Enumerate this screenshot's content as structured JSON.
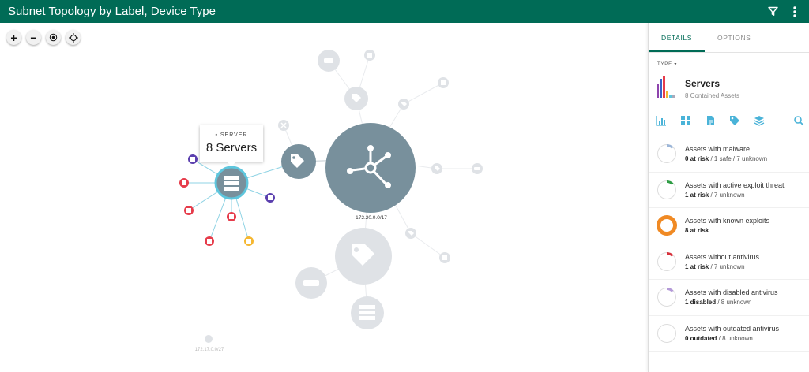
{
  "header": {
    "title": "Subnet Topology by Label, Device Type"
  },
  "zoom": {
    "zoom_in": "+",
    "zoom_out": "−"
  },
  "graph": {
    "main_node_label": "172.20.0.0/17",
    "small_node_label": "172.17.0.0/27",
    "tooltip": {
      "kicker": "SERVER",
      "value": "8 Servers"
    },
    "colors": {
      "hub": "#78909c",
      "faded": "#dfe2e6",
      "edge": "#cfe8f0",
      "highlight": "#5ec6dd",
      "red": "#e63c4b",
      "purple": "#5b3fae",
      "yellow": "#f5b731"
    }
  },
  "panel": {
    "tabs": [
      "DETAILS",
      "OPTIONS"
    ],
    "type_label": "TYPE",
    "name": "Servers",
    "subtitle": "8 Contained Assets",
    "risks": [
      {
        "title": "Assets with malware",
        "count": "0 at risk",
        "rest": " / 1 safe / 7 unknown",
        "color": "#9cb6d8",
        "fraction": 0.125
      },
      {
        "title": "Assets with active exploit threat",
        "count": "1 at risk",
        "rest": " / 7 unknown",
        "color": "#2e9d44",
        "fraction": 0.125
      },
      {
        "title": "Assets with known exploits",
        "count": "8 at risk",
        "rest": "",
        "color": "#f08a24",
        "fraction": 1.0
      },
      {
        "title": "Assets without antivirus",
        "count": "1 at risk",
        "rest": " / 7 unknown",
        "color": "#d8313c",
        "fraction": 0.125
      },
      {
        "title": "Assets with disabled antivirus",
        "count": "1 disabled",
        "rest": " / 8 unknown",
        "color": "#b49ad8",
        "fraction": 0.125
      },
      {
        "title": "Assets with outdated antivirus",
        "count": "0 outdated",
        "rest": " / 8 unknown",
        "color": "#cccccc",
        "fraction": 0
      }
    ]
  }
}
